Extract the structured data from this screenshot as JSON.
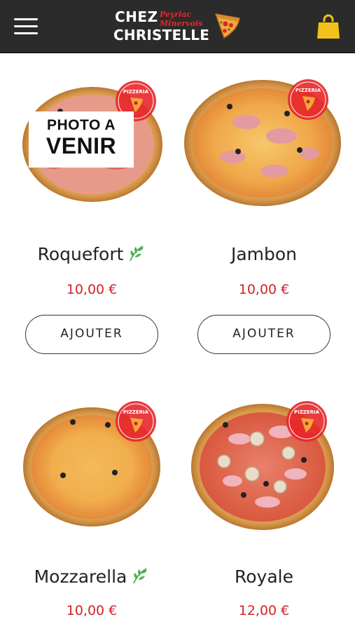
{
  "header": {
    "logo": {
      "line1": "CHEZ",
      "line2": "CHRISTELLE",
      "town1": "Peyriac",
      "town2": "Minervois"
    },
    "menu_icon": "hamburger-menu-icon",
    "cart_icon": "shopping-bag-icon"
  },
  "colors": {
    "header_bg": "#2b2b2b",
    "price": "#d2232a",
    "veg_icon": "#4caf50",
    "badge": "#e8262a"
  },
  "products": [
    {
      "name": "Roquefort",
      "price": "10,00 €",
      "button": "AJOUTER",
      "vegetarian": true,
      "placeholder_line1": "PHOTO A",
      "placeholder_line2": "VENIR",
      "badge_text": "PIZZERIA"
    },
    {
      "name": "Jambon",
      "price": "10,00 €",
      "button": "AJOUTER",
      "vegetarian": false,
      "badge_text": "PIZZERIA"
    },
    {
      "name": "Mozzarella",
      "price": "10,00 €",
      "vegetarian": true,
      "badge_text": "PIZZERIA"
    },
    {
      "name": "Royale",
      "price": "12,00 €",
      "vegetarian": false,
      "badge_text": "PIZZERIA"
    }
  ]
}
